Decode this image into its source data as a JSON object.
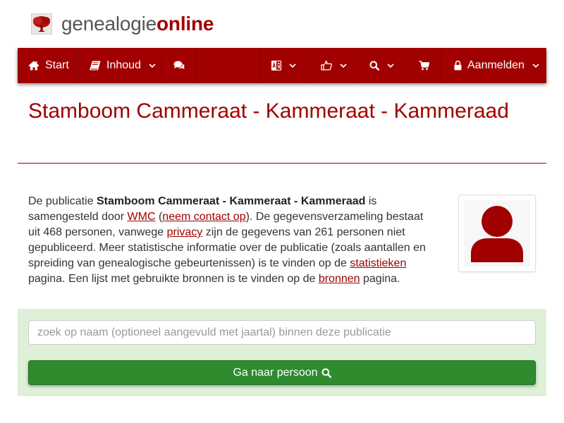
{
  "brand": {
    "part1": "genealogie",
    "part2": "online"
  },
  "nav": {
    "start_label": "Start",
    "contents_label": "Inhoud",
    "login_label": "Aanmelden"
  },
  "page": {
    "title": "Stamboom Cammeraat - Kammeraat - Kammeraad"
  },
  "description": {
    "text1": "De publicatie ",
    "pub_name": "Stamboom Cammeraat - Kammeraat - Kammeraad",
    "text2": " is samengesteld door ",
    "author_link": "WMC",
    "text3": " (",
    "contact_link": "neem contact op",
    "text4": "). De gegevensverzameling bestaat uit 468 personen, vanwege ",
    "privacy_link": "privacy",
    "text5": " zijn de gegevens van 261 personen niet gepubliceerd. Meer statistische informatie over de publicatie (zoals aantallen en spreiding van genealogische gebeurtenissen) is te vinden op de ",
    "stats_link": "statistieken",
    "text6": " pagina. Een lijst met gebruikte bronnen is te vinden op de ",
    "sources_link": "bronnen",
    "text7": " pagina."
  },
  "search": {
    "placeholder": "zoek op naam (optioneel aangevuld met jaartal) binnen deze publicatie",
    "button_label": "Ga naar persoon"
  },
  "colors": {
    "brand_red": "#a00000",
    "panel_green": "#dff0d8",
    "button_green": "#2e8b2e"
  },
  "icons": [
    "tree-logo-icon",
    "home-icon",
    "book-icon",
    "comments-icon",
    "language-icon",
    "thumbs-up-icon",
    "search-icon",
    "cart-icon",
    "lock-icon",
    "chevron-down-icon",
    "user-avatar-icon"
  ]
}
